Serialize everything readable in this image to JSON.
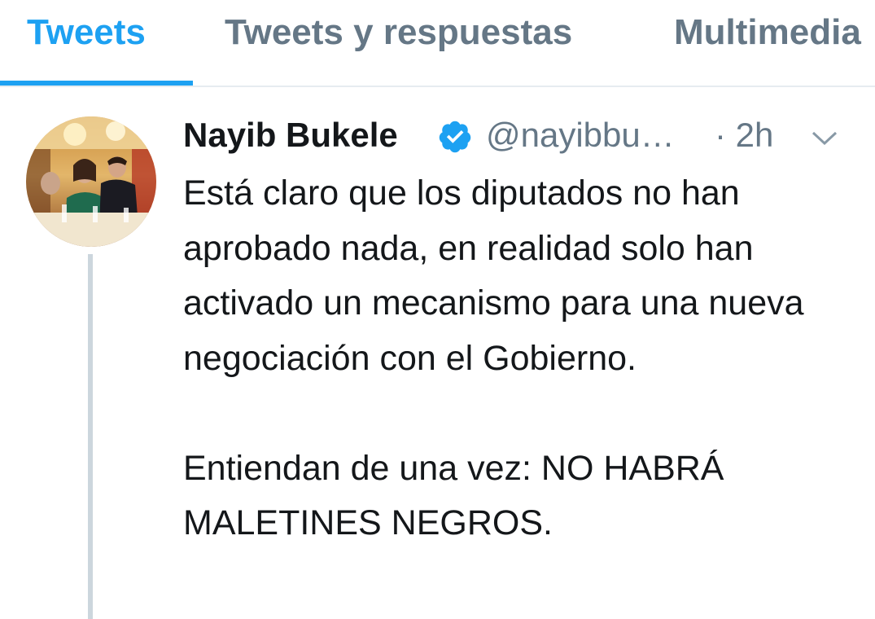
{
  "tabs": [
    {
      "label": "Tweets",
      "active": true
    },
    {
      "label": "Tweets y respuestas",
      "active": false
    },
    {
      "label": "Multimedia",
      "active": false
    }
  ],
  "tweet": {
    "author_name": "Nayib Bukele",
    "verified": true,
    "handle": "@nayibbu…",
    "time": "· 2h",
    "paragraphs": [
      "Está claro que los diputados no han aprobado nada, en realidad solo han activado un mecanismo para una nueva negociación con el Gobierno.",
      "Entiendan de una vez: NO HABRÁ MALETINES NEGROS."
    ],
    "avatar_icon": "avatar-photo",
    "menu_icon": "chevron-down-icon"
  },
  "colors": {
    "accent": "#1da1f2",
    "text": "#14171a",
    "muted": "#657786",
    "thread_line": "#ccd6dd",
    "divider": "#e6ecf0"
  }
}
